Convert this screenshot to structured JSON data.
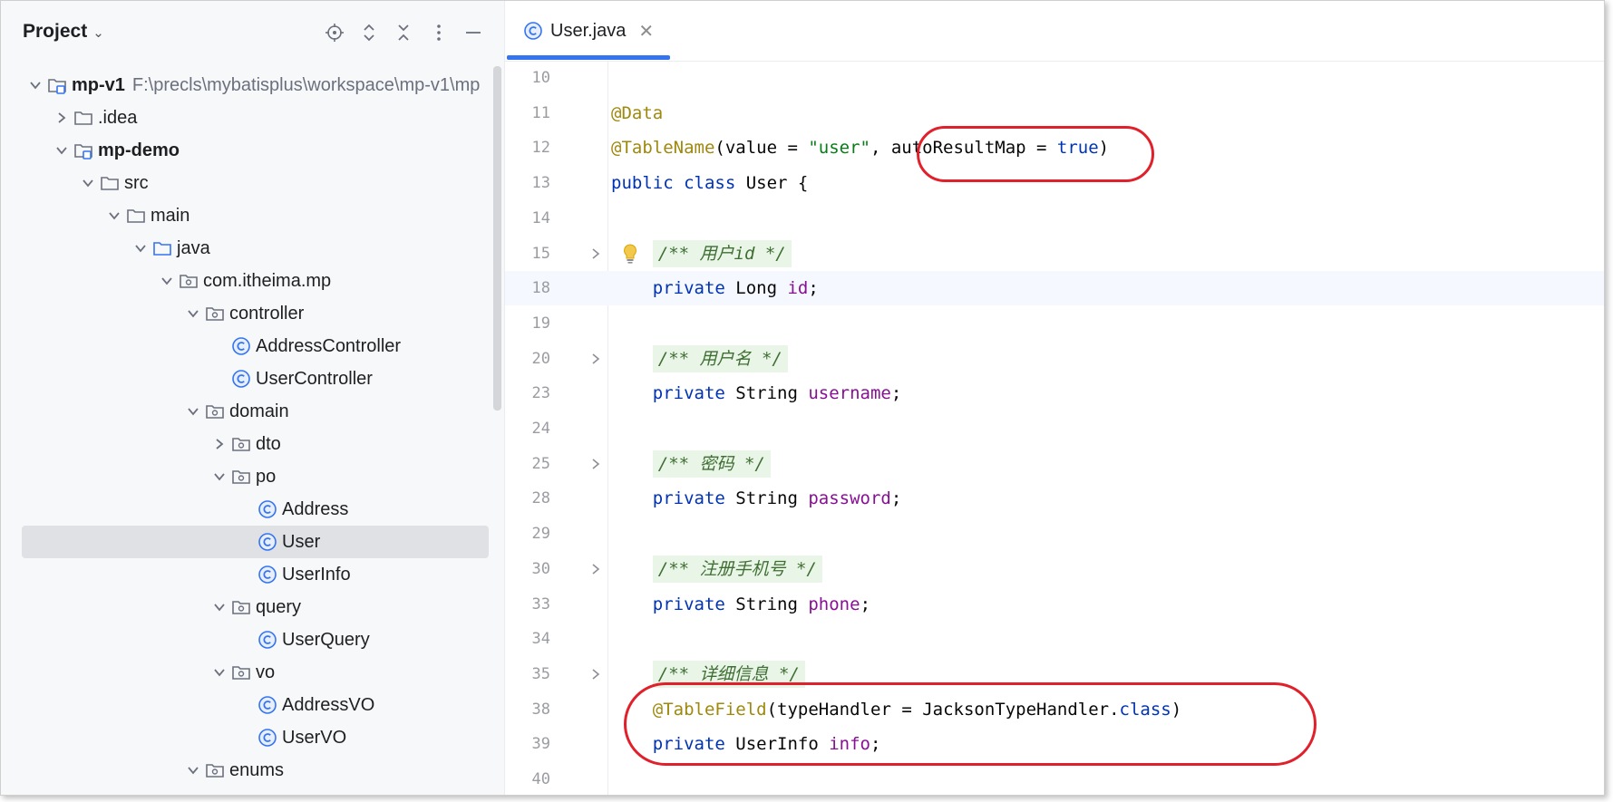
{
  "panel": {
    "title": "Project",
    "toolbar_icons": [
      "locate-icon",
      "expand-all-icon",
      "collapse-all-icon",
      "options-icon",
      "hide-icon"
    ]
  },
  "tree": [
    {
      "label": "mp-v1",
      "path": "F:\\precls\\mybatisplus\\workspace\\mp-v1\\mp",
      "depth": 0,
      "type": "module",
      "expanded": true,
      "bold": true
    },
    {
      "label": ".idea",
      "depth": 1,
      "type": "folder",
      "expanded": false
    },
    {
      "label": "mp-demo",
      "depth": 1,
      "type": "module",
      "expanded": true,
      "bold": true
    },
    {
      "label": "src",
      "depth": 2,
      "type": "folder",
      "expanded": true
    },
    {
      "label": "main",
      "depth": 3,
      "type": "folder",
      "expanded": true
    },
    {
      "label": "java",
      "depth": 4,
      "type": "source-folder",
      "expanded": true
    },
    {
      "label": "com.itheima.mp",
      "depth": 5,
      "type": "package",
      "expanded": true
    },
    {
      "label": "controller",
      "depth": 6,
      "type": "package",
      "expanded": true
    },
    {
      "label": "AddressController",
      "depth": 7,
      "type": "class"
    },
    {
      "label": "UserController",
      "depth": 7,
      "type": "class"
    },
    {
      "label": "domain",
      "depth": 6,
      "type": "package",
      "expanded": true
    },
    {
      "label": "dto",
      "depth": 7,
      "type": "package",
      "expanded": false
    },
    {
      "label": "po",
      "depth": 7,
      "type": "package",
      "expanded": true
    },
    {
      "label": "Address",
      "depth": 8,
      "type": "class"
    },
    {
      "label": "User",
      "depth": 8,
      "type": "class",
      "selected": true
    },
    {
      "label": "UserInfo",
      "depth": 8,
      "type": "class"
    },
    {
      "label": "query",
      "depth": 7,
      "type": "package",
      "expanded": true
    },
    {
      "label": "UserQuery",
      "depth": 8,
      "type": "class"
    },
    {
      "label": "vo",
      "depth": 7,
      "type": "package",
      "expanded": true
    },
    {
      "label": "AddressVO",
      "depth": 8,
      "type": "class"
    },
    {
      "label": "UserVO",
      "depth": 8,
      "type": "class"
    },
    {
      "label": "enums",
      "depth": 6,
      "type": "package",
      "expanded": true
    }
  ],
  "editor": {
    "tab_label": "User.java",
    "tab_icon": "class-icon",
    "current_line": "18",
    "lines": [
      {
        "n": "10",
        "tokens": []
      },
      {
        "n": "11",
        "tokens": [
          {
            "t": "@Data",
            "c": "ann"
          }
        ]
      },
      {
        "n": "12",
        "tokens": [
          {
            "t": "@TableName",
            "c": "ann"
          },
          {
            "t": "(value = ",
            "c": ""
          },
          {
            "t": "\"user\"",
            "c": "str"
          },
          {
            "t": ", autoResultMap = ",
            "c": ""
          },
          {
            "t": "true",
            "c": "kw"
          },
          {
            "t": ")",
            "c": ""
          }
        ]
      },
      {
        "n": "13",
        "tokens": [
          {
            "t": "public class ",
            "c": "kw"
          },
          {
            "t": "User {",
            "c": ""
          }
        ]
      },
      {
        "n": "14",
        "tokens": []
      },
      {
        "n": "15",
        "fold": true,
        "bulb": true,
        "tokens": [
          {
            "t": "    ",
            "c": ""
          },
          {
            "t": "/** 用户id */",
            "c": "doc"
          }
        ]
      },
      {
        "n": "18",
        "tokens": [
          {
            "t": "    ",
            "c": ""
          },
          {
            "t": "private ",
            "c": "kw"
          },
          {
            "t": "Long ",
            "c": ""
          },
          {
            "t": "id",
            "c": "fld"
          },
          {
            "t": ";",
            "c": ""
          }
        ]
      },
      {
        "n": "19",
        "tokens": []
      },
      {
        "n": "20",
        "fold": true,
        "tokens": [
          {
            "t": "    ",
            "c": ""
          },
          {
            "t": "/** 用户名 */",
            "c": "doc"
          }
        ]
      },
      {
        "n": "23",
        "tokens": [
          {
            "t": "    ",
            "c": ""
          },
          {
            "t": "private ",
            "c": "kw"
          },
          {
            "t": "String ",
            "c": ""
          },
          {
            "t": "username",
            "c": "fld"
          },
          {
            "t": ";",
            "c": ""
          }
        ]
      },
      {
        "n": "24",
        "tokens": []
      },
      {
        "n": "25",
        "fold": true,
        "tokens": [
          {
            "t": "    ",
            "c": ""
          },
          {
            "t": "/** 密码 */",
            "c": "doc"
          }
        ]
      },
      {
        "n": "28",
        "tokens": [
          {
            "t": "    ",
            "c": ""
          },
          {
            "t": "private ",
            "c": "kw"
          },
          {
            "t": "String ",
            "c": ""
          },
          {
            "t": "password",
            "c": "fld"
          },
          {
            "t": ";",
            "c": ""
          }
        ]
      },
      {
        "n": "29",
        "tokens": []
      },
      {
        "n": "30",
        "fold": true,
        "tokens": [
          {
            "t": "    ",
            "c": ""
          },
          {
            "t": "/** 注册手机号 */",
            "c": "doc"
          }
        ]
      },
      {
        "n": "33",
        "tokens": [
          {
            "t": "    ",
            "c": ""
          },
          {
            "t": "private ",
            "c": "kw"
          },
          {
            "t": "String ",
            "c": ""
          },
          {
            "t": "phone",
            "c": "fld"
          },
          {
            "t": ";",
            "c": ""
          }
        ]
      },
      {
        "n": "34",
        "tokens": []
      },
      {
        "n": "35",
        "fold": true,
        "tokens": [
          {
            "t": "    ",
            "c": ""
          },
          {
            "t": "/** 详细信息 */",
            "c": "doc"
          }
        ]
      },
      {
        "n": "38",
        "tokens": [
          {
            "t": "    ",
            "c": ""
          },
          {
            "t": "@TableField",
            "c": "ann"
          },
          {
            "t": "(typeHandler = JacksonTypeHandler.",
            "c": ""
          },
          {
            "t": "class",
            "c": "kw"
          },
          {
            "t": ")",
            "c": ""
          }
        ]
      },
      {
        "n": "39",
        "tokens": [
          {
            "t": "    ",
            "c": ""
          },
          {
            "t": "private ",
            "c": "kw"
          },
          {
            "t": "UserInfo ",
            "c": ""
          },
          {
            "t": "info",
            "c": "fld"
          },
          {
            "t": ";",
            "c": ""
          }
        ]
      },
      {
        "n": "40",
        "tokens": []
      }
    ]
  },
  "colors": {
    "accent": "#3574f0",
    "selection": "#dfe1e5",
    "highlight_marker": "#e0202a",
    "keyword": "#0033b3",
    "annotation": "#9e880d",
    "string": "#067d17",
    "field": "#871094",
    "doc_comment": "#3f6e34"
  }
}
